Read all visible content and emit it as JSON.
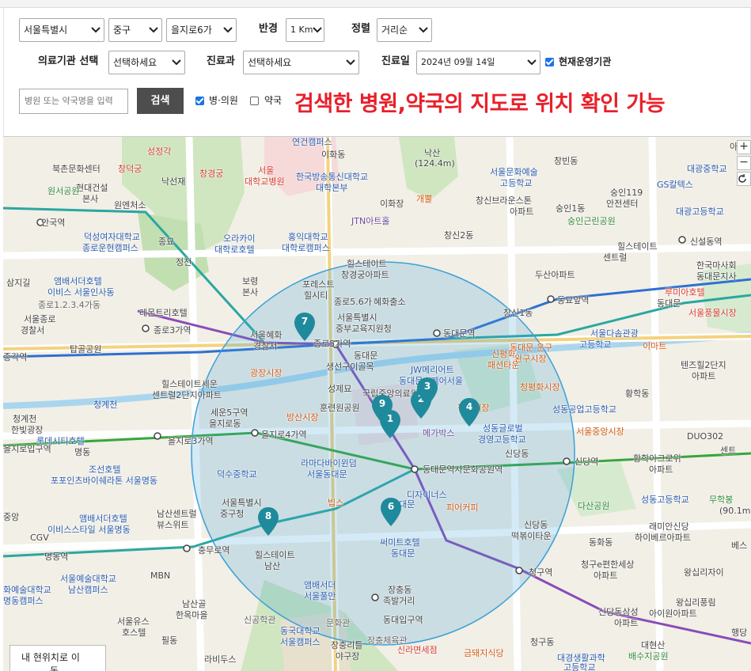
{
  "filters": {
    "region_city": "서울특별시",
    "region_district": "중구",
    "region_dong": "을지로6가",
    "radius_label": "반경",
    "radius_value": "1 Km",
    "sort_label": "정렬",
    "sort_value": "거리순",
    "institution_label": "의료기관 선택",
    "institution_value": "선택하세요",
    "department_label": "진료과",
    "department_value": "선택하세요",
    "date_label": "진료일",
    "date_value": "2024년 09월 14일",
    "open_now_label": "현재운영기관",
    "search_placeholder": "병원 또는 약국명을 입력",
    "search_button": "검색",
    "hospital_clinic_label": "병·의원",
    "pharmacy_label": "약국"
  },
  "banner": "검색한 병원,약국의 지도로 위치 확인 가능",
  "map": {
    "zoom_in": "+",
    "zoom_out": "−",
    "locate_button": "내 현위치로 이",
    "locate_button_line2": "동",
    "markers": [
      "1",
      "2",
      "3",
      "4",
      "6",
      "7",
      "8",
      "9"
    ],
    "colors": {
      "marker": "#1f8a9c",
      "radius_circle": "#3aa0d8",
      "line_green": "#35a73d",
      "line_purple": "#8a4bb8",
      "line_blue": "#2f6fd1",
      "line_teal": "#2aa7a0"
    },
    "labels": {
      "l1": "북촌문화센터",
      "l2": "창덕궁",
      "l3": "성정각",
      "l4": "낙선재",
      "l5": "창경궁",
      "l6": "서울",
      "l7": "대학교병원",
      "l8": "연건캠퍼스",
      "l9": "이화동",
      "l10": "한국방송통신대학교",
      "l11": "대학본부",
      "l12": "낙산",
      "l13": "(124.4m)",
      "l14": "이화장",
      "l15": "개뿔",
      "l16": "창신동",
      "l17": "서울문화예술",
      "l18": "고등학교",
      "l19": "창신브라운스톤",
      "l20": "아파트",
      "l21": "숭인1동",
      "l22": "숭인근린공원",
      "l23": "숭인119",
      "l24": "안전센터",
      "l25": "GS칼텍스",
      "l26": "대광중학교",
      "l27": "대광고등학교",
      "l28": "창빈동",
      "l29": "현대건설",
      "l30": "본사",
      "l31": "원서공원",
      "l32": "원엔처소",
      "l33": "안국역",
      "l34": "덕성여자대학교",
      "l35": "종로운현캠퍼스",
      "l36": "종묘",
      "l37": "정전",
      "l38": "오라카이",
      "l39": "대학로호텔",
      "l40": "홍익대학교",
      "l41": "대학로캠퍼스",
      "l42": "JTN아트홀",
      "l43": "창신2동",
      "l44": "힐스테이트",
      "l45": "창경궁아파트",
      "l46": "종로통가",
      "l47": "힐스테이트",
      "l48": "센트럴",
      "l49": "신설동역",
      "l50": "한국마사회",
      "l51": "동대문지사",
      "l52": "삼지길",
      "l53": "앰배서더호텔",
      "l54": "이비스 서울인사동",
      "l55": "종로1.2.3.4가동",
      "l56": "보령",
      "l57": "본사",
      "l58": "포레스트",
      "l59": "힐시티",
      "l60": "종로5.6가",
      "l61": "혜화출소",
      "l62": "두산아파트",
      "l63": "루미아호텔",
      "l64": "동대문",
      "l65": "동묘앞역",
      "l66": "창신1동",
      "l67": "서울풍물시장",
      "l68": "서울종로",
      "l69": "경찰서",
      "l70": "레몬트리호텔",
      "l71": "종로3가역",
      "l72": "서울특별시",
      "l73": "중부교육지원청",
      "l74": "서울혜화",
      "l75": "경찰서",
      "l76": "종로5가역",
      "l77": "동대문역",
      "l78": "서울다솜관광",
      "l79": "고등학교",
      "l80": "이마트",
      "l81": "탑골공원",
      "l82": "종각역",
      "l83": "광장시장",
      "l84": "동대문",
      "l85": "생선구이골목",
      "l86": "JW메리어트",
      "l87": "동대문스퀘어서울",
      "l88": "신평화",
      "l89": "패션타운",
      "l90": "동대문 운구",
      "l91": "완구시장",
      "l92": "텐즈힐2단지",
      "l93": "아파트",
      "l94": "청평화시장",
      "l95": "황학동",
      "l96": "힐스테이트세운",
      "l97": "센트럴2단지아파트",
      "l98": "성제묘",
      "l99": "국립중앙의료원",
      "l100": "훈련원공원",
      "l101": "청계천",
      "l102": "한빛광장",
      "l103": "세운5구역",
      "l104": "을지로동",
      "l105": "방산시장",
      "l106": "을지로3가역",
      "l107": "을지로4가역",
      "l108": "메가박스",
      "l109": "평화시장",
      "l110": "성동공업고등학교",
      "l111": "성동글로벌",
      "l112": "경영고등학교",
      "l113": "서울중앙시장",
      "l114": "DUO302",
      "l115": "롯데시티호텔",
      "l116": "명동",
      "l117": "조선호텔",
      "l118": "포포인츠바이쉐라톤 서울명동",
      "l119": "을지로입구역",
      "l120": "신당동",
      "l121": "신당역",
      "l122": "황학아크로위",
      "l123": "아파트",
      "l124": "라마다바이윈덤",
      "l125": "서울동대문",
      "l126": "동대문역사문화공원역",
      "l127": "덕수중학교",
      "l128": "성동고등학교",
      "l129": "다산공원",
      "l130": "무학봉",
      "l131": "서울특별시",
      "l132": "중구청",
      "l133": "남산센트럴",
      "l134": "뷰스위트",
      "l135": "앰배서더호텔",
      "l136": "이비스스타일 서울명동",
      "l137": "빕스",
      "l138": "디자이너스",
      "l139": "동대문",
      "l140": "피어커피",
      "l141": "신당동",
      "l142": "떡볶이타운",
      "l143": "동화동",
      "l144": "래미안신당",
      "l145": "하이베르아파트",
      "l146": "명동역",
      "l147": "충무로역",
      "l148": "힐스테이트",
      "l149": "남산",
      "l150": "써미트호텔",
      "l151": "동대문",
      "l152": "청구역",
      "l153": "청구e편한세상",
      "l154": "아파트",
      "l155": "왕십리자이",
      "l156": "서울예술대학교",
      "l157": "남산캠퍼스",
      "l158": "MBN",
      "l159": "장충동",
      "l160": "족발거리",
      "l161": "남산골",
      "l162": "한옥마을",
      "l163": "앰배서더",
      "l164": "서울풀만",
      "l165": "동대입구역",
      "l166": "신당동삼성",
      "l167": "아파트",
      "l168": "왕십리풍림",
      "l169": "아이원아파트",
      "l170": "서울유스",
      "l171": "호스텔",
      "l172": "신공학관",
      "l173": "문화관",
      "l174": "동국대학교",
      "l175": "서울캠퍼스",
      "l176": "장충리틀",
      "l177": "야구장",
      "l178": "신라면세점",
      "l179": "금돼지식당",
      "l180": "청구동",
      "l181": "대경생활과학",
      "l182": "고등학교",
      "l183": "대현산",
      "l184": "배수지공원",
      "l185": "필동",
      "l186": "라비두스",
      "l187": "장충체육관",
      "l188": "CGV",
      "l189": "화예술대학교",
      "l190": "명동캠퍼스",
      "l191": "중앙",
      "l192": "신상",
      "l193": "성동",
      "l194": "행당",
      "l195": "센트",
      "l196": "아파",
      "l197": "(90.1m)",
      "l198": "베스",
      "l199": "광장",
      "l200": "종로역",
      "l201": "청계천"
    }
  }
}
